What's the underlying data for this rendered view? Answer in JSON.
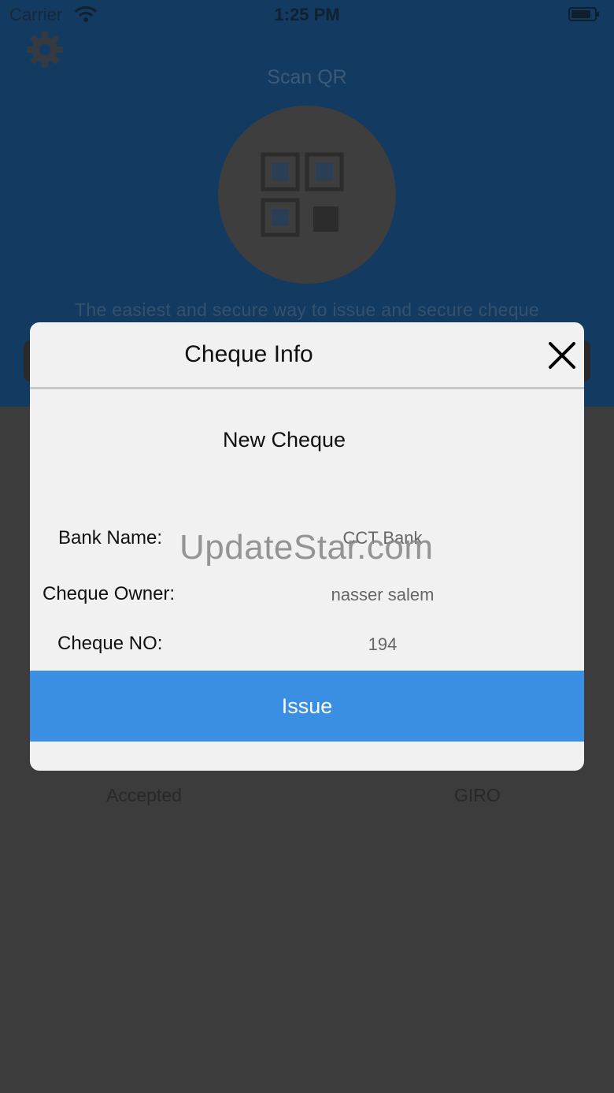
{
  "status_bar": {
    "carrier": "Carrier",
    "time": "1:25 PM"
  },
  "background": {
    "scan_title": "Scan QR",
    "tagline": "The easiest and secure way to issue and secure cheque",
    "tabs": [
      "Accepted",
      "GIRO"
    ],
    "header_color": "#133a60"
  },
  "modal": {
    "title": "Cheque Info",
    "subtitle": "New Cheque",
    "fields": [
      {
        "label": "Bank Name:",
        "value": "CCT Bank"
      },
      {
        "label": "Cheque Owner:",
        "value": "nasser salem"
      },
      {
        "label": "Cheque NO:",
        "value": "194"
      }
    ],
    "issue_label": "Issue",
    "accent_color": "#3a8fe3"
  },
  "watermark": "UpdateStar.com",
  "icons": {
    "settings": "gear-icon",
    "qr": "qr-code-icon",
    "close": "close-icon",
    "wifi": "wifi-icon",
    "battery": "battery-icon"
  }
}
